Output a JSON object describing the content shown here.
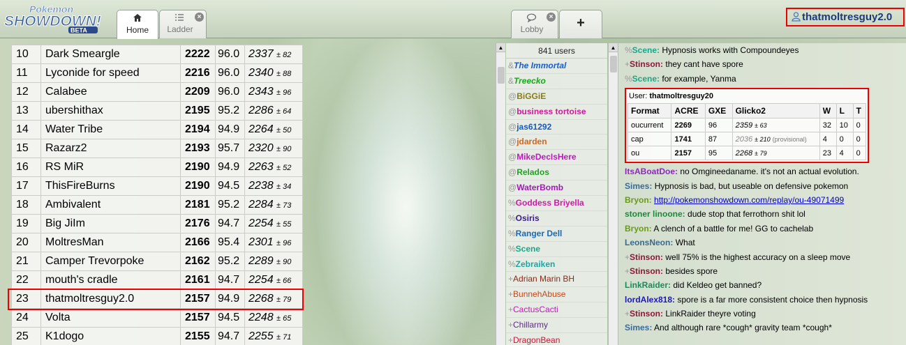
{
  "header": {
    "logo": {
      "top": "Pokémon",
      "main": "SHOWDOWN!",
      "badge": "BETA"
    },
    "left_tabs": [
      {
        "label": "Home",
        "icon": "home-icon",
        "active": true
      },
      {
        "label": "Ladder",
        "icon": "list-icon",
        "active": false,
        "closable": true
      }
    ],
    "right_tabs": [
      {
        "label": "Lobby",
        "icon": "chat-bubble-icon",
        "closable": true
      },
      {
        "label": "+",
        "icon": "plus-icon"
      }
    ],
    "username": "thatmoltresguy2.0"
  },
  "ladder": {
    "rows": [
      {
        "rank": "10",
        "name": "Dark Smeargle",
        "elo": "2222",
        "gxe": "96.0",
        "g2": "2337",
        "dev": "± 82"
      },
      {
        "rank": "11",
        "name": "Lyconide for speed",
        "elo": "2216",
        "gxe": "96.0",
        "g2": "2340",
        "dev": "± 88"
      },
      {
        "rank": "12",
        "name": "Calabee",
        "elo": "2209",
        "gxe": "96.0",
        "g2": "2343",
        "dev": "± 96"
      },
      {
        "rank": "13",
        "name": "ubershithax",
        "elo": "2195",
        "gxe": "95.2",
        "g2": "2286",
        "dev": "± 64"
      },
      {
        "rank": "14",
        "name": "Water Tribe",
        "elo": "2194",
        "gxe": "94.9",
        "g2": "2264",
        "dev": "± 50"
      },
      {
        "rank": "15",
        "name": "Razarz2",
        "elo": "2193",
        "gxe": "95.7",
        "g2": "2320",
        "dev": "± 90"
      },
      {
        "rank": "16",
        "name": "RS MiR",
        "elo": "2190",
        "gxe": "94.9",
        "g2": "2263",
        "dev": "± 52"
      },
      {
        "rank": "17",
        "name": "ThisFireBurns",
        "elo": "2190",
        "gxe": "94.5",
        "g2": "2238",
        "dev": "± 34"
      },
      {
        "rank": "18",
        "name": "Ambivalent",
        "elo": "2181",
        "gxe": "95.2",
        "g2": "2284",
        "dev": "± 73"
      },
      {
        "rank": "19",
        "name": "Big JiIm",
        "elo": "2176",
        "gxe": "94.7",
        "g2": "2254",
        "dev": "± 55"
      },
      {
        "rank": "20",
        "name": "MoltresMan",
        "elo": "2166",
        "gxe": "95.4",
        "g2": "2301",
        "dev": "± 96"
      },
      {
        "rank": "21",
        "name": "Camper Trevorpoke",
        "elo": "2162",
        "gxe": "95.2",
        "g2": "2289",
        "dev": "± 90"
      },
      {
        "rank": "22",
        "name": "mouth's cradle",
        "elo": "2161",
        "gxe": "94.7",
        "g2": "2254",
        "dev": "± 66"
      },
      {
        "rank": "23",
        "name": "thatmoltresguy2.0",
        "elo": "2157",
        "gxe": "94.9",
        "g2": "2268",
        "dev": "± 79",
        "highlight": true
      },
      {
        "rank": "24",
        "name": "Volta",
        "elo": "2157",
        "gxe": "94.5",
        "g2": "2248",
        "dev": "± 65"
      },
      {
        "rank": "25",
        "name": "K1dogo",
        "elo": "2155",
        "gxe": "94.7",
        "g2": "2255",
        "dev": "± 71"
      }
    ]
  },
  "userlist": {
    "count": "841 users",
    "users": [
      {
        "group": "&",
        "name": "The Immortal",
        "color": "#1a5fc8",
        "italic": true
      },
      {
        "group": "&",
        "name": "Treecko",
        "color": "#1aa81a",
        "italic": true
      },
      {
        "group": "@",
        "name": "BiGGiE",
        "color": "#8a7a18"
      },
      {
        "group": "@",
        "name": "business tortoise",
        "color": "#d0189a"
      },
      {
        "group": "@",
        "name": "jas61292",
        "color": "#1a5ab8"
      },
      {
        "group": "@",
        "name": "jdarden",
        "color": "#d86418"
      },
      {
        "group": "@",
        "name": "MikeDecIsHere",
        "color": "#c018c0"
      },
      {
        "group": "@",
        "name": "Relados",
        "color": "#18a818"
      },
      {
        "group": "@",
        "name": "WaterBomb",
        "color": "#a018b8"
      },
      {
        "group": "%",
        "name": "Goddess Briyella",
        "color": "#d018a8"
      },
      {
        "group": "%",
        "name": "Osiris",
        "color": "#3a1a8a"
      },
      {
        "group": "%",
        "name": "Ranger Dell",
        "color": "#1a6ab8"
      },
      {
        "group": "%",
        "name": "Scene",
        "color": "#18a888"
      },
      {
        "group": "%",
        "name": "Zebraiken",
        "color": "#18a8a8"
      },
      {
        "group": "+",
        "name": "Adrian Marin BH",
        "color": "#8a2a18",
        "plain": true
      },
      {
        "group": "+",
        "name": "BunnehAbuse",
        "color": "#c84818",
        "plain": true
      },
      {
        "group": "+",
        "name": "CactusCacti",
        "color": "#c018b8",
        "plain": true
      },
      {
        "group": "+",
        "name": "Chillarmy",
        "color": "#5a2a8a",
        "plain": true
      },
      {
        "group": "+",
        "name": "DragonBean",
        "color": "#c81838",
        "plain": true
      }
    ]
  },
  "chat": {
    "before": [
      {
        "group": "%",
        "name": "Scene:",
        "color": "#18a888",
        "text": "Hypnosis works with Compoundeyes"
      },
      {
        "group": "+",
        "name": "Stinson:",
        "color": "#8a1838",
        "text": "they cant have spore"
      },
      {
        "group": "%",
        "name": "Scene:",
        "color": "#18a888",
        "text": "for example, Yanma"
      }
    ],
    "rating": {
      "label": "User:",
      "user": "thatmoltresguy20",
      "headers": [
        "Format",
        "ACRE",
        "GXE",
        "Glicko2",
        "W",
        "L",
        "T"
      ],
      "rows": [
        {
          "format": "oucurrent",
          "acre": "2269",
          "gxe": "96",
          "g2": "2359",
          "dev": "± 63",
          "note": "",
          "w": "32",
          "l": "10",
          "t": "0"
        },
        {
          "format": "cap",
          "acre": "1741",
          "gxe": "87",
          "g2": "2036",
          "dev": "± 210",
          "note": "(provisional)",
          "w": "4",
          "l": "0",
          "t": "0"
        },
        {
          "format": "ou",
          "acre": "2157",
          "gxe": "95",
          "g2": "2268",
          "dev": "± 79",
          "note": "",
          "w": "23",
          "l": "4",
          "t": "0"
        }
      ]
    },
    "after": [
      {
        "group": "",
        "name": "ItsABoatDoe:",
        "color": "#8a2ab8",
        "text": "no Omgineedaname. it's not an actual evolution."
      },
      {
        "group": "",
        "name": "Simes:",
        "color": "#3a6a9a",
        "text": "Hypnosis is bad, but useable on defensive pokemon"
      },
      {
        "group": "",
        "name": "Bryon:",
        "color": "#6a9a1a",
        "link": "http://pokemonshowdown.com/replay/ou-49071499"
      },
      {
        "group": "",
        "name": "stoner linoone:",
        "color": "#1a8a3a",
        "text": "dude stop that ferrothorn shit lol"
      },
      {
        "group": "",
        "name": "Bryon:",
        "color": "#6a9a1a",
        "text": "A clench of a battle for me! GG to cachelab"
      },
      {
        "group": "",
        "name": "LeonsNeon:",
        "color": "#3a6a8a",
        "text": "What"
      },
      {
        "group": "+",
        "name": "Stinson:",
        "color": "#8a1838",
        "text": "well 75% is the highest accuracy on a sleep move"
      },
      {
        "group": "+",
        "name": "Stinson:",
        "color": "#8a1838",
        "text": "besides spore"
      },
      {
        "group": "",
        "name": "LinkRaider:",
        "color": "#1a8a5a",
        "text": "did Keldeo get banned?"
      },
      {
        "group": "",
        "name": "lordAlex818:",
        "color": "#1a1ab8",
        "text": "spore is a far more consistent choice then hypnosis"
      },
      {
        "group": "+",
        "name": "Stinson:",
        "color": "#8a1838",
        "text": "LinkRaider theyre voting"
      },
      {
        "group": "",
        "name": "Simes:",
        "color": "#3a6a9a",
        "text": "And although rare *cough* gravity team *cough*"
      }
    ]
  },
  "colors": {
    "highlight": "#e00000",
    "username": "#1c3a7a"
  }
}
